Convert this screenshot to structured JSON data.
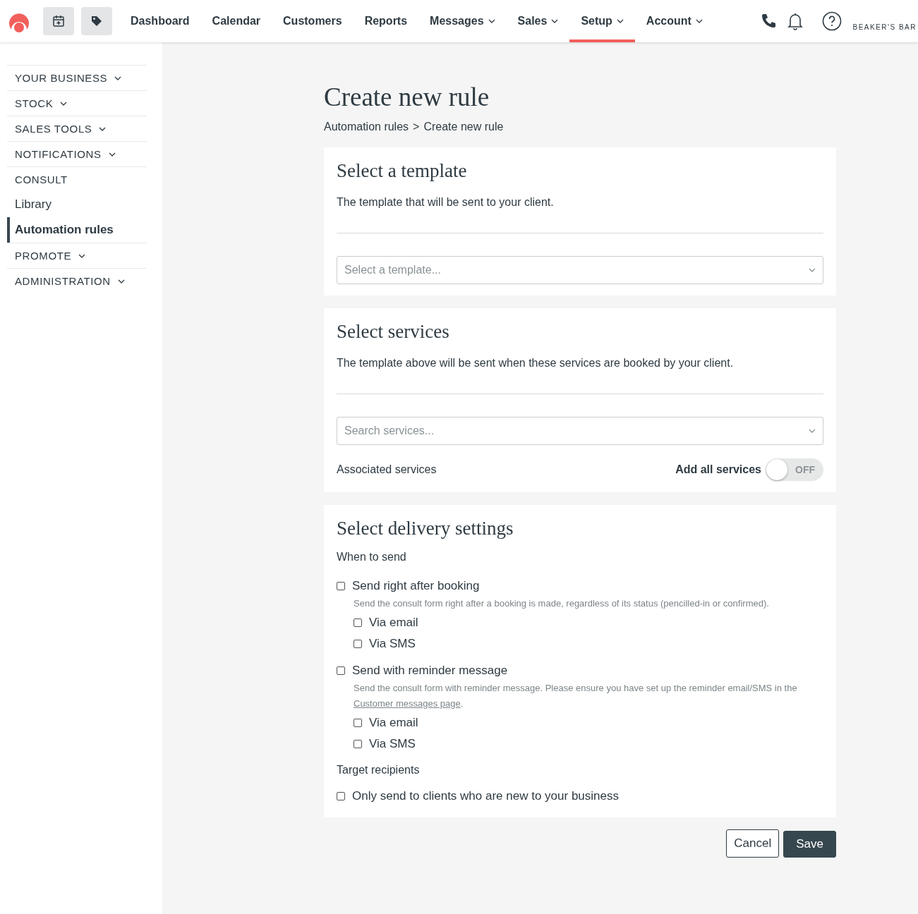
{
  "top_nav": {
    "items": [
      {
        "label": "Dashboard",
        "has_menu": false,
        "selected": false
      },
      {
        "label": "Calendar",
        "has_menu": false,
        "selected": false
      },
      {
        "label": "Customers",
        "has_menu": false,
        "selected": false
      },
      {
        "label": "Reports",
        "has_menu": false,
        "selected": false
      },
      {
        "label": "Messages",
        "has_menu": true,
        "selected": false
      },
      {
        "label": "Sales",
        "has_menu": true,
        "selected": false
      },
      {
        "label": "Setup",
        "has_menu": true,
        "selected": true
      },
      {
        "label": "Account",
        "has_menu": true,
        "selected": false
      }
    ],
    "business_name": "BEAKER'S BAR"
  },
  "sidebar": {
    "items": [
      {
        "label": "YOUR BUSINESS",
        "kind": "section",
        "expandable": true,
        "selected": false
      },
      {
        "label": "STOCK",
        "kind": "section",
        "expandable": true,
        "selected": false
      },
      {
        "label": "SALES TOOLS",
        "kind": "section",
        "expandable": true,
        "selected": false
      },
      {
        "label": "NOTIFICATIONS",
        "kind": "section",
        "expandable": true,
        "selected": false
      },
      {
        "label": "CONSULT",
        "kind": "section",
        "expandable": false,
        "selected": false
      },
      {
        "label": "Library",
        "kind": "link",
        "expandable": false,
        "selected": false
      },
      {
        "label": "Automation rules",
        "kind": "link",
        "expandable": false,
        "selected": true
      },
      {
        "label": "PROMOTE",
        "kind": "section",
        "expandable": true,
        "selected": false
      },
      {
        "label": "ADMINISTRATION",
        "kind": "section",
        "expandable": true,
        "selected": false
      }
    ]
  },
  "page": {
    "title": "Create new rule",
    "breadcrumb": [
      {
        "label": "Automation rules"
      },
      {
        "label": "Create new rule"
      }
    ],
    "breadcrumb_separator": ">"
  },
  "template_card": {
    "title": "Select a template",
    "description": "The template that will be sent to your client.",
    "select": {
      "placeholder": "Select a template..."
    }
  },
  "services_card": {
    "title": "Select services",
    "description": "The template above will be sent when these services are booked by your client.",
    "select": {
      "placeholder": "Search services..."
    },
    "associated_label": "Associated services",
    "add_all": {
      "label": "Add all services",
      "on": false,
      "state_text": "OFF"
    }
  },
  "delivery_card": {
    "title": "Select delivery settings",
    "when_label": "When to send",
    "options": [
      {
        "label": "Send right after booking",
        "checked": false,
        "help": {
          "text": "Send the consult form right after a booking is made, regardless of its status (pencilled-in or confirmed)."
        },
        "channels": [
          {
            "label": "Via email",
            "checked": false
          },
          {
            "label": "Via SMS",
            "checked": false
          }
        ]
      },
      {
        "label": "Send with reminder message",
        "checked": false,
        "help": {
          "text": "Send the consult form with reminder message. Please ensure you have set up the reminder email/SMS in the ",
          "link": "Customer messages page",
          "after": "."
        },
        "channels": [
          {
            "label": "Via email",
            "checked": false
          },
          {
            "label": "Via SMS",
            "checked": false
          }
        ]
      }
    ],
    "target_label": "Target recipients",
    "target_option": {
      "label": "Only send to clients who are new to your business",
      "checked": false
    }
  },
  "actions": [
    {
      "label": "Cancel",
      "kind": "secondary"
    },
    {
      "label": "Save",
      "kind": "primary"
    }
  ]
}
